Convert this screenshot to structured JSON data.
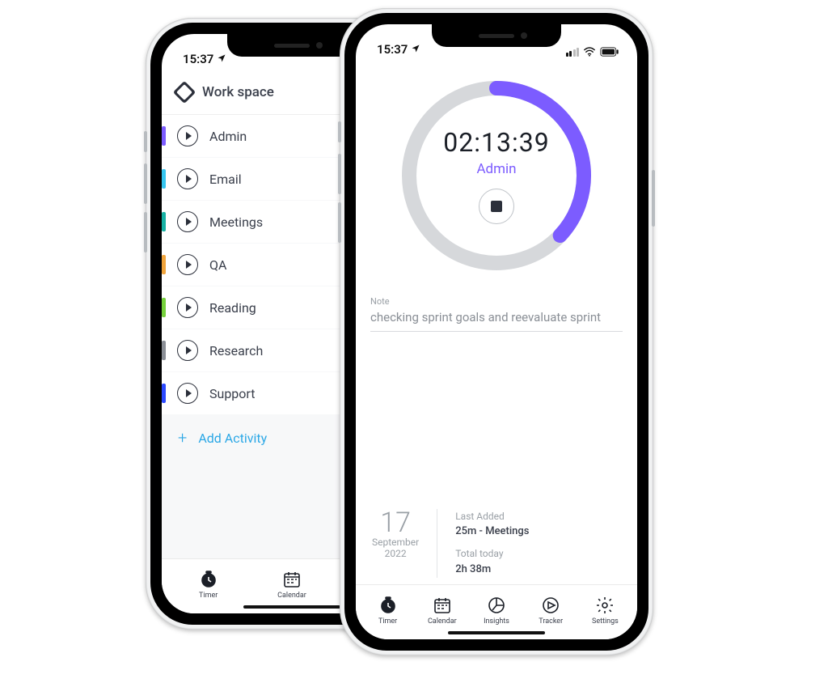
{
  "status": {
    "time": "15:37"
  },
  "workspace": {
    "title": "Work space",
    "activities": [
      {
        "label": "Admin",
        "color": "#7c5cff"
      },
      {
        "label": "Email",
        "color": "#36c6f0"
      },
      {
        "label": "Meetings",
        "color": "#17b1a4"
      },
      {
        "label": "QA",
        "color": "#f0a43c"
      },
      {
        "label": "Reading",
        "color": "#76d13c"
      },
      {
        "label": "Research",
        "color": "#8b8f96"
      },
      {
        "label": "Support",
        "color": "#2b49ff"
      }
    ],
    "add_label": "Add Activity"
  },
  "tabs": {
    "timer": "Timer",
    "calendar": "Calendar",
    "insights": "Insights",
    "tracker": "Tracker",
    "settings": "Settings"
  },
  "timer": {
    "elapsed": "02:13:39",
    "category": "Admin",
    "ring_color": "#7c5cff",
    "progress_pct": 37
  },
  "note": {
    "label": "Note",
    "text": "checking sprint goals and reevaluate sprint"
  },
  "date": {
    "day": "17",
    "month": "September",
    "year": "2022"
  },
  "stats": {
    "last_added_label": "Last Added",
    "last_added_value": "25m - Meetings",
    "total_today_label": "Total today",
    "total_today_value": "2h 38m"
  }
}
